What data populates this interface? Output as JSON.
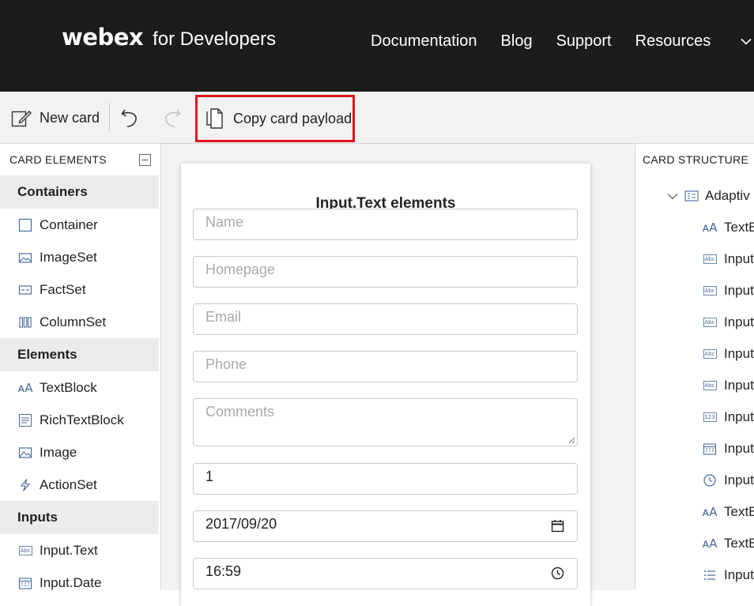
{
  "nav": {
    "brand_main": "webex",
    "brand_sub": "for Developers",
    "links": [
      "Documentation",
      "Blog",
      "Support",
      "Resources"
    ]
  },
  "toolbar": {
    "new_card": "New card",
    "copy_payload": "Copy card payload"
  },
  "left_panel": {
    "header": "CARD ELEMENTS",
    "categories": [
      {
        "label": "Containers",
        "items": [
          "Container",
          "ImageSet",
          "FactSet",
          "ColumnSet"
        ]
      },
      {
        "label": "Elements",
        "items": [
          "TextBlock",
          "RichTextBlock",
          "Image",
          "ActionSet"
        ]
      },
      {
        "label": "Inputs",
        "items": [
          "Input.Text",
          "Input.Date"
        ]
      }
    ]
  },
  "card": {
    "title": "Input.Text elements",
    "fields": [
      {
        "placeholder": "Name"
      },
      {
        "placeholder": "Homepage"
      },
      {
        "placeholder": "Email"
      },
      {
        "placeholder": "Phone"
      },
      {
        "placeholder": "Comments"
      },
      {
        "value": "1"
      },
      {
        "value": "2017/09/20"
      },
      {
        "value": "16:59"
      }
    ]
  },
  "right_panel": {
    "header": "CARD STRUCTURE",
    "root": "Adaptiv",
    "items": [
      "TextB",
      "Input",
      "Input",
      "Input",
      "Input",
      "Input",
      "Input",
      "Input",
      "Input",
      "TextB",
      "TextB",
      "Input"
    ]
  }
}
